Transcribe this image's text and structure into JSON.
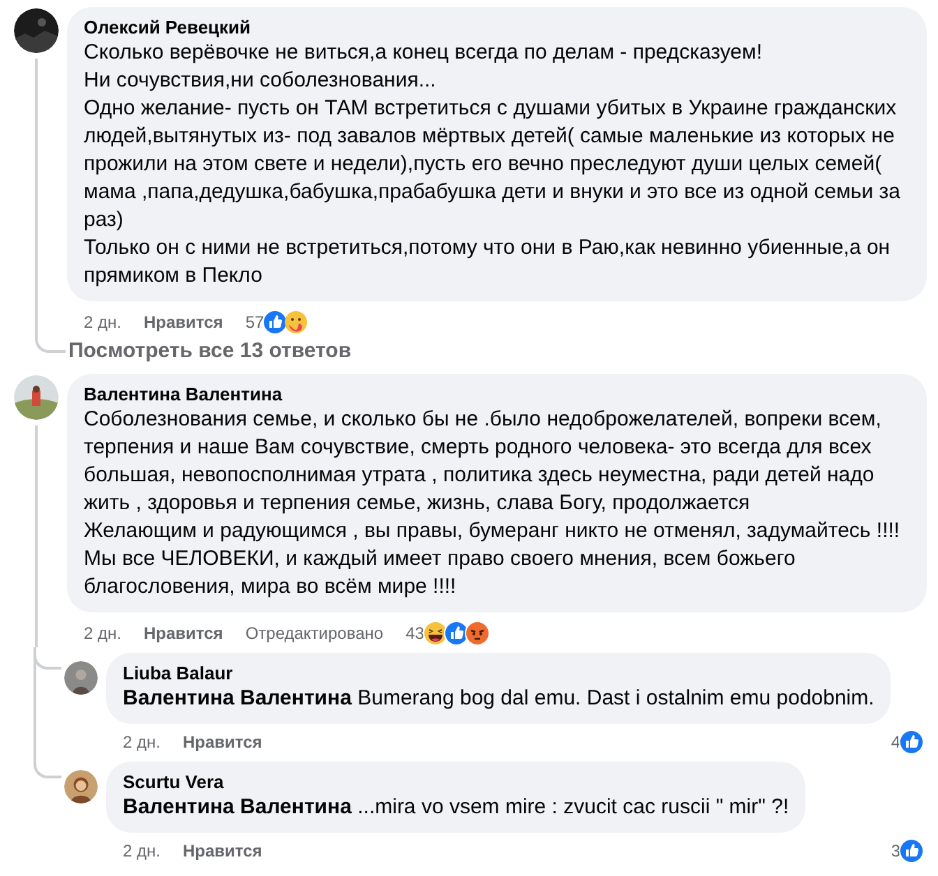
{
  "comments": [
    {
      "author": "Олексий Ревецкий",
      "paragraphs": [
        "Сколько верёвочке не виться,а конец всегда по делам - предсказуем!",
        "Ни сочувствия,ни соболезнования...",
        "Одно желание- пусть он ТАМ встретиться с душами убитых в Украине гражданских людей,вытянутых из- под завалов мёртвых детей( самые маленькие из которых не прожили на этом свете и недели),пусть его вечно преследуют души целых семей( мама ,папа,дедушка,бабушка,прабабушка дети и внуки и это все из одной семьи за раз)",
        "Только он с ними не встретиться,потому что они в Раю,как невинно убиенные,а он прямиком в Пекло"
      ],
      "time": "2 дн.",
      "like": "Нравится",
      "reaction_count": "57",
      "reactions": [
        {
          "kind": "like"
        },
        {
          "kind": "care"
        }
      ],
      "view_replies": "Посмотреть все 13 ответов"
    },
    {
      "author": "Валентина Валентина",
      "paragraphs": [
        "Соболезнования семье, и сколько бы не .было недоброжелателей, вопреки всем, терпения и наше Вам сочувствие, смерть родного человека- это всегда для всех большая, невопосполнимая утрата , политика здесь неуместна, ради детей надо жить , здоровья и терпения семье, жизнь, слава Богу, продолжается",
        "Желающим и радующимся , вы правы, бумеранг никто не отменял, задумайтесь !!!!",
        "Мы все ЧЕЛОВЕКИ, и каждый имеет право своего мнения, всем божьего благословения, мира во всём мире !!!!"
      ],
      "time": "2 дн.",
      "like": "Нравится",
      "edited": "Отредактировано",
      "reaction_count": "43",
      "reactions": [
        {
          "kind": "haha"
        },
        {
          "kind": "like"
        },
        {
          "kind": "angry"
        }
      ],
      "replies": [
        {
          "author": "Liuba Balaur",
          "mention": "Валентина Валентина",
          "text": "Bumerang bog dal emu. Dast i ostalnim emu podobnim.",
          "time": "2 дн.",
          "like": "Нравится",
          "reaction_count": "4",
          "reactions": [
            {
              "kind": "like"
            }
          ]
        },
        {
          "author": "Scurtu Vera",
          "mention": "Валентина Валентина",
          "text": "...mira vo vsem mire : zvucit cac ruscii \" mir\" ?!",
          "time": "2 дн.",
          "like": "Нравится",
          "reaction_count": "3",
          "reactions": [
            {
              "kind": "like"
            }
          ]
        }
      ]
    }
  ]
}
